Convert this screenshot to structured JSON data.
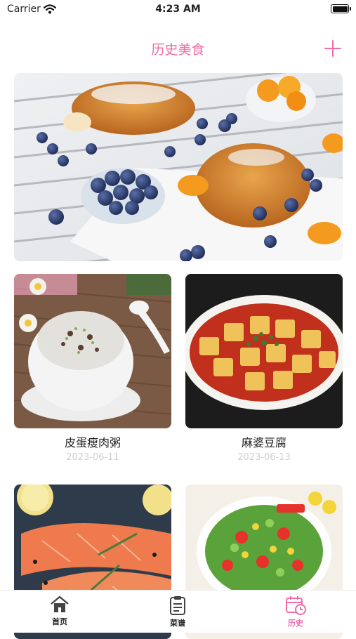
{
  "status_bar": {
    "carrier": "Carrier",
    "time": "4:23 AM"
  },
  "nav": {
    "title": "历史美食",
    "add_icon": "plus-icon"
  },
  "colors": {
    "accent": "#ef6ca6",
    "date_text": "#cfcfcf"
  },
  "recipes": [
    {
      "name": "皮蛋瘦肉粥",
      "date": "2023-06-11"
    },
    {
      "name": "麻婆豆腐",
      "date": "2023-06-13"
    },
    {
      "name": "",
      "date": ""
    },
    {
      "name": "",
      "date": ""
    }
  ],
  "tab_bar": {
    "items": [
      {
        "label": "首页",
        "icon": "home-icon",
        "active": false
      },
      {
        "label": "菜谱",
        "icon": "clipboard-icon",
        "active": false
      },
      {
        "label": "历史",
        "icon": "calendar-clock-icon",
        "active": true
      }
    ]
  }
}
